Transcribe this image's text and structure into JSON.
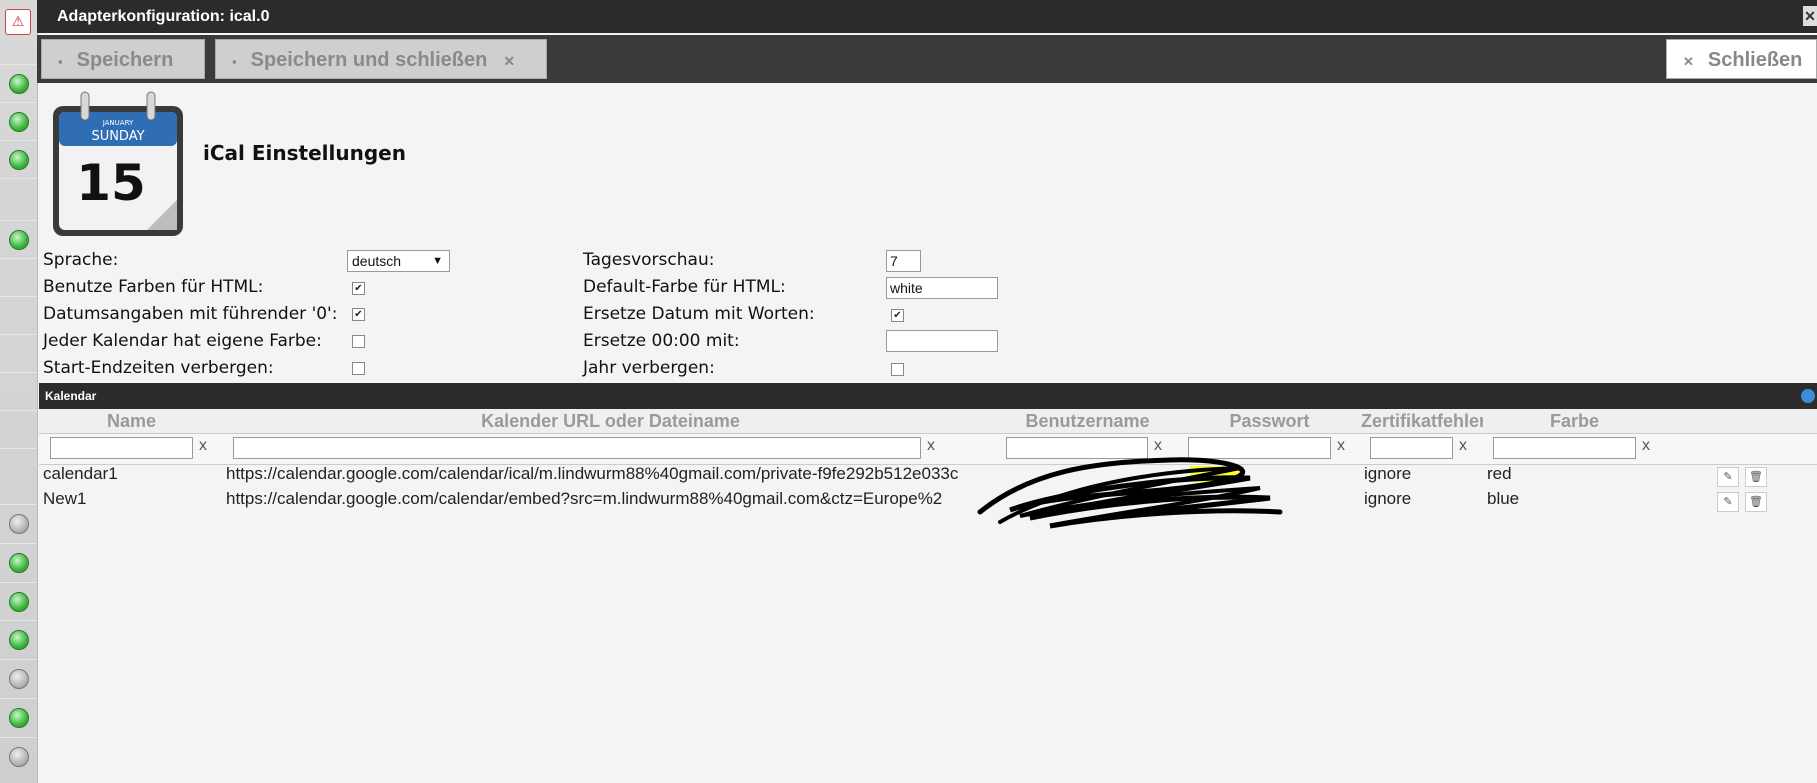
{
  "window": {
    "title": "Adapterkonfiguration: ical.0"
  },
  "toolbar": {
    "save_label": "Speichern",
    "save_close_label": "Speichern und schließen",
    "close_label": "Schließen"
  },
  "page": {
    "title": "iCal Einstellungen",
    "logo_month": "JANUARY",
    "logo_day": "SUNDAY",
    "logo_date": "15"
  },
  "settings": {
    "language_label": "Sprache:",
    "language_value": "deutsch",
    "use_colors_label": "Benutze Farben für HTML:",
    "leading_zero_label": "Datumsangaben mit führender '0':",
    "own_color_label": "Jeder Kalendar hat eigene Farbe:",
    "hide_times_label": "Start-Endzeiten verbergen:",
    "preview_label": "Tagesvorschau:",
    "preview_value": "7",
    "default_color_label": "Default-Farbe für HTML:",
    "default_color_value": "white",
    "replace_date_label": "Ersetze Datum mit Worten:",
    "replace_midnight_label": "Ersetze 00:00 mit:",
    "replace_midnight_value": "",
    "hide_year_label": "Jahr verbergen:"
  },
  "grid": {
    "title": "Kalendar",
    "columns": [
      "Name",
      "Kalender URL oder Dateiname",
      "Benutzername",
      "Passwort",
      "Zertifikatfehler",
      "Farbe"
    ],
    "filter_clear": "x",
    "rows": [
      {
        "name": "calendar1",
        "url": "https://calendar.google.com/calendar/ical/m.lindwurm88%40gmail.com/private-f9fe292b512e033c",
        "cert": "ignore",
        "color": "red"
      },
      {
        "name": "New1",
        "url": "https://calendar.google.com/calendar/embed?src=m.lindwurm88%40gmail.com&ctz=Europe%2",
        "cert": "ignore",
        "color": "blue"
      }
    ]
  },
  "icons": [
    "save-icon",
    "close-icon",
    "edit-icon",
    "delete-icon",
    "status-dot-icon"
  ]
}
